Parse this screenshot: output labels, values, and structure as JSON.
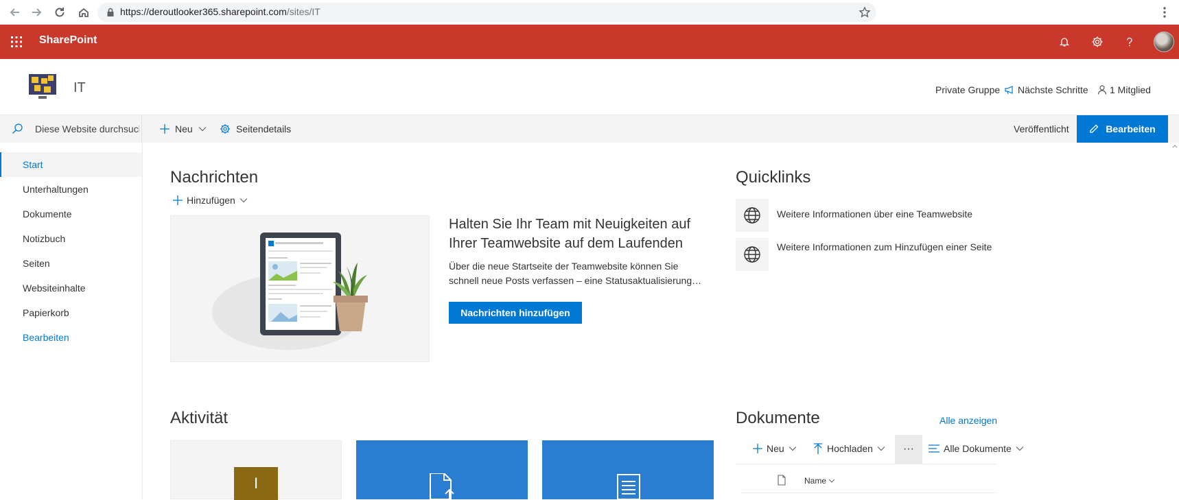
{
  "browser": {
    "url_host": "https://deroutlooker365.sharepoint.com",
    "url_path": "/sites/IT"
  },
  "suitebar": {
    "title": "SharePoint",
    "color": "#c9382b"
  },
  "site": {
    "title": "IT",
    "privacy": "Private Gruppe",
    "next_steps": "Nächste Schritte",
    "members": "1 Mitglied"
  },
  "commandbar": {
    "search_placeholder": "Diese Website durchsuchen",
    "new_label": "Neu",
    "page_details_label": "Seitendetails",
    "published_label": "Veröffentlicht",
    "edit_label": "Bearbeiten"
  },
  "leftnav": {
    "items": [
      {
        "label": "Start",
        "active": true
      },
      {
        "label": "Unterhaltungen"
      },
      {
        "label": "Dokumente"
      },
      {
        "label": "Notizbuch"
      },
      {
        "label": "Seiten"
      },
      {
        "label": "Websiteinhalte"
      },
      {
        "label": "Papierkorb"
      },
      {
        "label": "Bearbeiten",
        "link": true
      }
    ]
  },
  "news": {
    "title": "Nachrichten",
    "add_label": "Hinzufügen",
    "heading": "Halten Sie Ihr Team mit Neuigkeiten auf Ihrer Teamwebsite auf dem Laufenden",
    "text": "Über die neue Startseite der Teamwebsite können Sie schnell neue Posts verfassen – eine Statusaktualisierung…",
    "button": "Nachrichten hinzufügen"
  },
  "quicklinks": {
    "title": "Quicklinks",
    "items": [
      {
        "label": "Weitere Informationen über eine Teamwebsite",
        "icon": "globe-icon"
      },
      {
        "label": "Weitere Informationen zum Hinzufügen einer Seite",
        "icon": "globe-icon"
      }
    ]
  },
  "activity": {
    "title": "Aktivität",
    "card1_letter": "I"
  },
  "documents": {
    "title": "Dokumente",
    "see_all": "Alle anzeigen",
    "new_label": "Neu",
    "upload_label": "Hochladen",
    "more_label": "···",
    "view_label": "Alle Dokumente",
    "name_column": "Name"
  },
  "colors": {
    "accent": "#0078d4",
    "suitebar": "#c9382b"
  }
}
